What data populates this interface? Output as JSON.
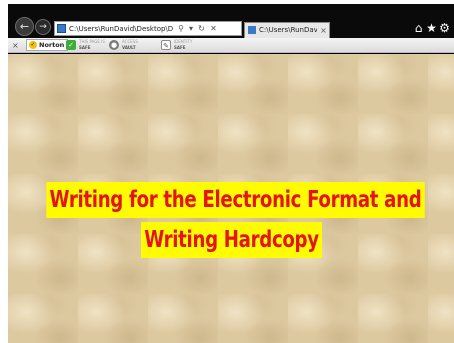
{
  "browser": {
    "address_url": "C:\\Users\\RunDavid\\Desktop\\Dropbox\\Wri",
    "address_search_icon": "search-icon",
    "address_refresh_icon": "refresh-icon",
    "address_stop_icon": "close-icon",
    "tab": {
      "title": "C:\\Users\\RunDavid\\...",
      "close_label": "×"
    },
    "right_icons": [
      "home-icon",
      "star-icon",
      "gear-icon"
    ]
  },
  "toolbar": {
    "close_label": "×",
    "norton_label": "Norton",
    "items": [
      {
        "top": "THIS PAGE IS",
        "bottom": "SAFE",
        "icon": "check-icon",
        "color": "#3cae3c"
      },
      {
        "top": "ACCESS",
        "bottom": "VAULT",
        "icon": "vault-icon",
        "color": "#7a7a7a"
      },
      {
        "top": "IDENTITY",
        "bottom": "SAFE",
        "icon": "pencil-icon",
        "color": "#7a7a7a"
      }
    ]
  },
  "page": {
    "title_line1": "Writing for the Electronic Format and",
    "title_line2": "Writing Hardcopy",
    "title_color": "#e4141b",
    "highlight_color": "#fffb00",
    "background_color": "#ddc9a0"
  }
}
